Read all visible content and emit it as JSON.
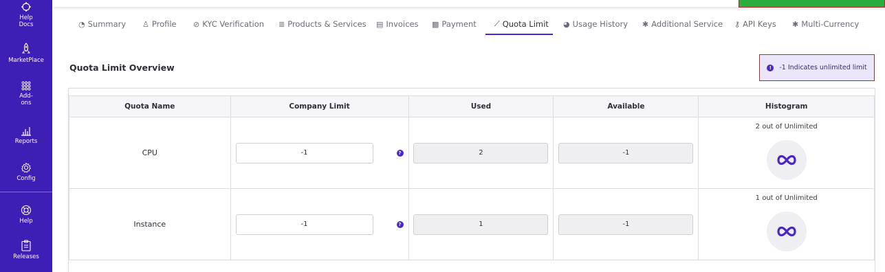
{
  "sidebar": {
    "items": [
      {
        "label_lines": [
          "Help",
          "Docs"
        ],
        "icon": "help-docs-icon"
      },
      {
        "label_lines": [
          "MarketPlace"
        ],
        "icon": "rocket-icon"
      },
      {
        "label_lines": [
          "Add-",
          "ons"
        ],
        "icon": "grid-dots-icon"
      },
      {
        "label_lines": [
          "Reports"
        ],
        "icon": "bar-chart-icon"
      },
      {
        "label_lines": [
          "Config"
        ],
        "icon": "gear-icon"
      },
      {
        "label_lines": [
          "Help"
        ],
        "icon": "lifebuoy-icon"
      },
      {
        "label_lines": [
          "Releases"
        ],
        "icon": "clipboard-icon"
      }
    ],
    "background": "#3d1fb5"
  },
  "tabs": [
    {
      "label": "Summary",
      "icon": "dashboard-icon"
    },
    {
      "label": "Profile",
      "icon": "user-icon"
    },
    {
      "label": "KYC Verification",
      "icon": "check-circle-icon"
    },
    {
      "label": "Products & Services",
      "icon": "list-icon"
    },
    {
      "label": "Invoices",
      "icon": "document-icon"
    },
    {
      "label": "Payment",
      "icon": "money-icon"
    },
    {
      "label": "Quota Limit",
      "icon": "line-chart-icon",
      "active": true
    },
    {
      "label": "Usage History",
      "icon": "pie-chart-icon"
    },
    {
      "label": "Additional Service",
      "icon": "gear-icon"
    },
    {
      "label": "API Keys",
      "icon": "key-icon"
    },
    {
      "label": "Multi-Currency",
      "icon": "gear-icon"
    }
  ],
  "section": {
    "title": "Quota Limit Overview",
    "note": "-1 Indicates unlimited limit"
  },
  "table": {
    "headers": [
      "Quota Name",
      "Company Limit",
      "Used",
      "Available",
      "Histogram"
    ],
    "rows": [
      {
        "name": "CPU",
        "limit": "-1",
        "used": "2",
        "available": "-1",
        "histogram": "2 out of Unlimited"
      },
      {
        "name": "Instance",
        "limit": "-1",
        "used": "1",
        "available": "-1",
        "histogram": "1 out of Unlimited"
      }
    ]
  },
  "colors": {
    "accent": "#4a27c9",
    "toast": "#27ae3d",
    "note_bg": "#ece6fb"
  }
}
